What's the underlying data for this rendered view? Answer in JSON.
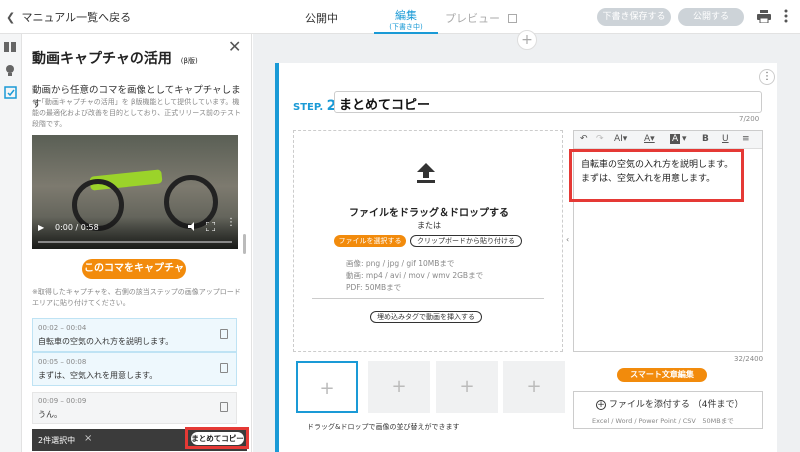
{
  "topbar": {
    "back_label": "マニュアル一覧へ戻る",
    "tabs": [
      {
        "label": "公開中"
      },
      {
        "label": "編集",
        "sub": "(下書き中)"
      },
      {
        "label": "プレビュー"
      }
    ],
    "save_draft_label": "下書き保存する",
    "publish_label": "公開する"
  },
  "panel": {
    "title": "動画キャプチャの活用",
    "beta": "(β版)",
    "lead": "動画から任意のコマを画像としてキャプチャします",
    "note": "※「動画キャプチャの活用」を β版機能として提供しています。機能の最適化および改善を目的としており、正式リリース前のテスト段階です。",
    "video_time": "0:00 / 0:58",
    "capture_button": "このコマをキャプチャ",
    "capture_note": "※取得したキャプチャを、右側の該当ステップの画像アップロードエリアに貼り付けてください。",
    "segments": [
      {
        "time": "00:02 – 00:04",
        "text": "自転車の空気の入れ方を説明します。"
      },
      {
        "time": "00:05 – 00:08",
        "text": "まずは、空気入れを用意します。"
      },
      {
        "time": "00:09 – 00:09",
        "text": "うん。"
      }
    ],
    "selection_count": "2件選択中",
    "selection_close": "×",
    "copy_button": "まとめてコピー"
  },
  "step": {
    "label": "STEP.",
    "number": "2",
    "title": "まとめてコピー",
    "title_counter": "7/200"
  },
  "upload": {
    "drop_text": "ファイルをドラッグ＆ドロップする",
    "or": "または",
    "select_file": "ファイルを選択する",
    "paste_clipboard": "クリップボードから貼り付ける",
    "formats_image": "画像: png / jpg / gif 10MBまで",
    "formats_video": "動画: mp4 / avi / mov / wmv 2GBまで",
    "formats_pdf": "PDF: 50MBまで",
    "embed_video": "埋め込みタグで動画を挿入する",
    "reorder_hint": "ドラッグ&ドロップで画像の並び替えができます"
  },
  "editor": {
    "text_line1": "自転車の空気の入れ方を説明します。",
    "text_line2": "まずは、空気入れを用意します。",
    "counter": "32/2400",
    "smart_button": "スマート文章編集",
    "attach_label": "ファイルを添付する （4件まで）",
    "attach_formats": "Excel / Word / Power Point / CSV　50MBまで"
  },
  "colors": {
    "accent": "#1a9ad6",
    "orange": "#f28b0c",
    "highlight": "#e53935"
  }
}
